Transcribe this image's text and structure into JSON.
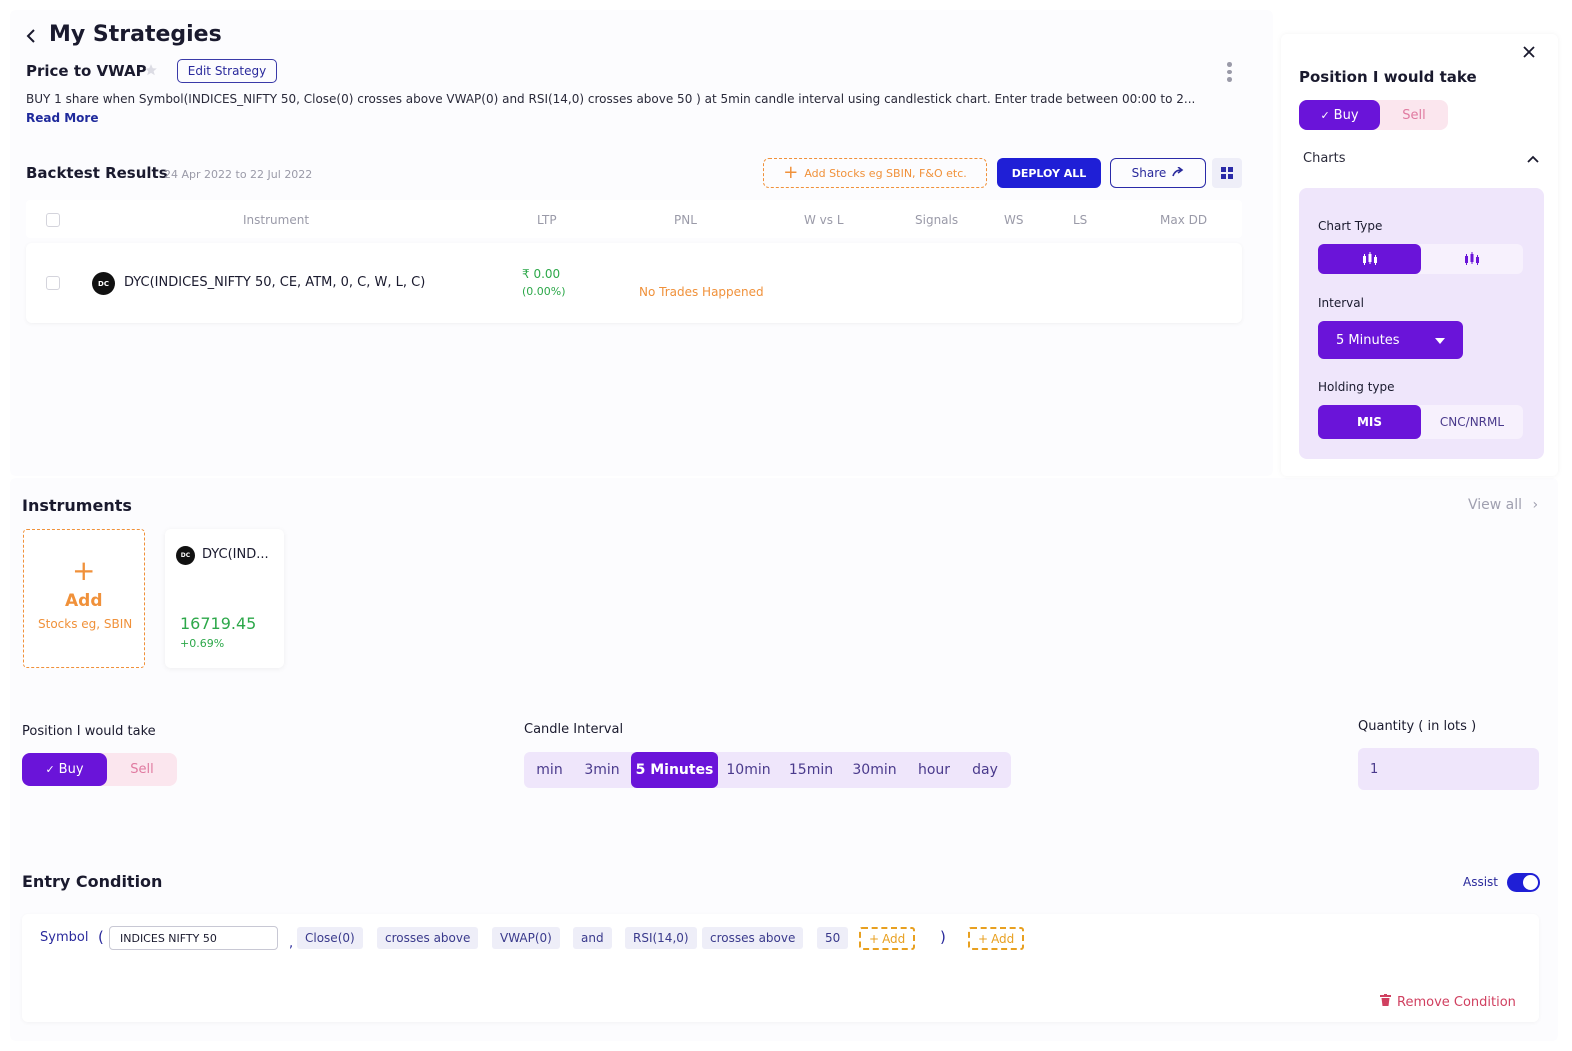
{
  "page": {
    "back_icon": "chevron-left-icon",
    "title": "My Strategies",
    "strategy_name": "Price to VWAP",
    "star_icon": "star-icon",
    "edit_label": "Edit Strategy",
    "description": "BUY 1 share when Symbol(INDICES_NIFTY 50, Close(0) crosses above VWAP(0) and RSI(14,0) crosses above 50 ) at 5min candle interval using candlestick chart. Enter trade between 00:00 to 2...",
    "read_more": "Read More",
    "more_icon": "kebab-menu-icon"
  },
  "backtest": {
    "title": "Backtest Results",
    "date_range": "24 Apr 2022 to 22 Jul 2022",
    "add_stocks_label": "Add Stocks eg SBIN, F&O etc.",
    "deploy_label": "DEPLOY ALL",
    "share_label": "Share",
    "share_icon": "share-arrow-icon",
    "grid_icon": "grid-view-icon",
    "columns": [
      "Instrument",
      "LTP",
      "PNL",
      "W vs L",
      "Signals",
      "WS",
      "LS",
      "Max DD"
    ],
    "rows": [
      {
        "badge": "DC",
        "instrument": "DYC(INDICES_NIFTY 50, CE, ATM, 0, C, W, L, C)",
        "ltp": "₹ 0.00",
        "ltp_pct": "(0.00%)",
        "pnl": "No Trades Happened"
      }
    ]
  },
  "side_panel": {
    "close_icon": "close-icon",
    "title": "Position I would take",
    "buy_label": "Buy",
    "sell_label": "Sell",
    "charts_label": "Charts",
    "collapse_icon": "chevron-up-icon",
    "chart_type_label": "Chart Type",
    "chart_type_icons": [
      "candlestick-icon",
      "heikin-ashi-icon"
    ],
    "interval_label": "Interval",
    "interval_value": "5 Minutes",
    "holding_label": "Holding type",
    "holding_options": [
      "MIS",
      "CNC/NRML"
    ]
  },
  "instruments": {
    "title": "Instruments",
    "view_all": "View all",
    "add_label": "Add",
    "add_sub": "Stocks eg, SBIN",
    "cards": [
      {
        "badge": "DC",
        "name": "DYC(IND...",
        "price": "16719.45",
        "change": "+0.69%"
      }
    ]
  },
  "position": {
    "label": "Position I would take",
    "buy_label": "Buy",
    "sell_label": "Sell"
  },
  "candle": {
    "label": "Candle Interval",
    "options": [
      "min",
      "3min",
      "5 Minutes",
      "10min",
      "15min",
      "30min",
      "hour",
      "day"
    ],
    "selected": "5 Minutes"
  },
  "quantity": {
    "label": "Quantity ( in lots )",
    "value": "1"
  },
  "entry": {
    "title": "Entry Condition",
    "assist_label": "Assist",
    "symbol_label": "Symbol",
    "open_paren": "(",
    "symbol_value": "INDICES NIFTY 50",
    "comma": ",",
    "chips": [
      "Close(0)",
      "crosses above",
      "VWAP(0)",
      "and",
      "RSI(14,0)",
      "crosses above",
      "50"
    ],
    "add_label": "Add",
    "close_paren": ")",
    "remove_label": "Remove Condition",
    "trash_icon": "trash-icon"
  },
  "colors": {
    "primary_purple": "#6a14d9",
    "deploy_blue": "#1f1fd6",
    "accent_orange": "#f0913a",
    "green": "#2da84a",
    "light_purple_bg": "#efe6fb",
    "sell_pink": "#fbe6ee"
  }
}
